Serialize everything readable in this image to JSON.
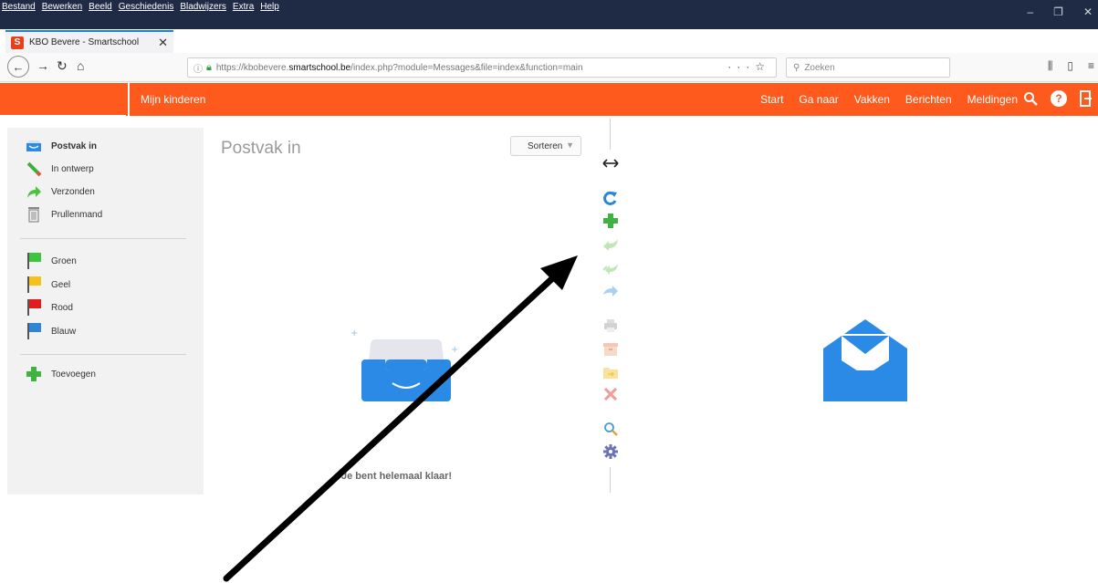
{
  "browser": {
    "menu": [
      "Bestand",
      "Bewerken",
      "Beeld",
      "Geschiedenis",
      "Bladwijzers",
      "Extra",
      "Help"
    ],
    "tab_title": "KBO Bevere - Smartschool",
    "tab_favicon_letter": "S",
    "url_prefix": "https://kbobevere.",
    "url_domain": "smartschool.be",
    "url_suffix": "/index.php?module=Messages&file=index&function=main",
    "search_placeholder": "Zoeken"
  },
  "appbar": {
    "tab_label": "Mijn kinderen",
    "nav": [
      "Start",
      "Ga naar",
      "Vakken",
      "Berichten",
      "Meldingen"
    ],
    "accent": "#fe5a1d"
  },
  "sidebar": {
    "folders": [
      {
        "label": "Postvak in",
        "icon": "inbox-icon"
      },
      {
        "label": "In ontwerp",
        "icon": "pencil-icon"
      },
      {
        "label": "Verzonden",
        "icon": "sent-arrow-icon"
      },
      {
        "label": "Prullenmand",
        "icon": "trash-icon"
      }
    ],
    "flags": [
      {
        "label": "Groen",
        "color": "#3ec43e"
      },
      {
        "label": "Geel",
        "color": "#f6c21a"
      },
      {
        "label": "Rood",
        "color": "#e11c1c"
      },
      {
        "label": "Blauw",
        "color": "#2f86d6"
      }
    ],
    "add_label": "Toevoegen"
  },
  "messages": {
    "title": "Postvak in",
    "sort_label": "Sorteren",
    "empty_text": "Je bent helemaal klaar!"
  },
  "toolbar_icons": [
    "resize-icon",
    "refresh-icon",
    "new-message-icon",
    "reply-icon",
    "reply-all-icon",
    "forward-icon",
    "print-icon",
    "archive-icon",
    "move-folder-icon",
    "delete-icon",
    "search-icon",
    "settings-icon"
  ]
}
